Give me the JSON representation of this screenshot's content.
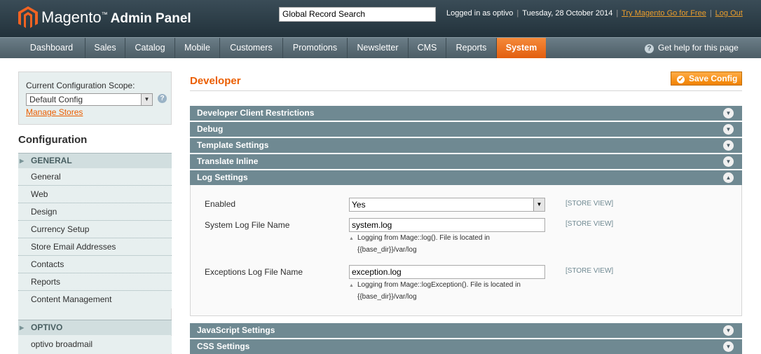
{
  "header": {
    "logo_text": "Magento",
    "logo_sub": "Admin Panel",
    "search_value": "Global Record Search",
    "logged_in": "Logged in as optivo",
    "date": "Tuesday, 28 October 2014",
    "try_link": "Try Magento Go for Free",
    "logout_link": "Log Out",
    "colors": {
      "header_bg": "#2c3c45",
      "link": "#eb9d2b"
    }
  },
  "nav": {
    "items": [
      "Dashboard",
      "Sales",
      "Catalog",
      "Mobile",
      "Customers",
      "Promotions",
      "Newsletter",
      "CMS",
      "Reports",
      "System"
    ],
    "active": "System",
    "help": "Get help for this page"
  },
  "sidebar": {
    "scope_label": "Current Configuration Scope:",
    "scope_value": "Default Config",
    "manage_stores": "Manage Stores",
    "config_title": "Configuration",
    "sections": [
      {
        "title": "GENERAL",
        "items": [
          "General",
          "Web",
          "Design",
          "Currency Setup",
          "Store Email Addresses",
          "Contacts",
          "Reports",
          "Content Management"
        ]
      },
      {
        "title": "OPTIVO",
        "items": [
          "optivo broadmail"
        ]
      }
    ]
  },
  "main": {
    "title": "Developer",
    "save_button": "Save Config",
    "fieldsets": [
      "Developer Client Restrictions",
      "Debug",
      "Template Settings",
      "Translate Inline",
      "Log Settings",
      "JavaScript Settings",
      "CSS Settings"
    ],
    "log_settings": {
      "enabled_label": "Enabled",
      "enabled_value": "Yes",
      "system_log_label": "System Log File Name",
      "system_log_value": "system.log",
      "system_log_note_1": "Logging from Mage::log(). File is located in",
      "system_log_note_2": "{{base_dir}}/var/log",
      "exception_log_label": "Exceptions Log File Name",
      "exception_log_value": "exception.log",
      "exception_log_note_1": "Logging from Mage::logException(). File is located in",
      "exception_log_note_2": "{{base_dir}}/var/log",
      "scope_tag": "[STORE VIEW]"
    },
    "colors": {
      "fieldset_head": "#6f8992",
      "title": "#eb5e00",
      "button": "#f18200"
    }
  }
}
